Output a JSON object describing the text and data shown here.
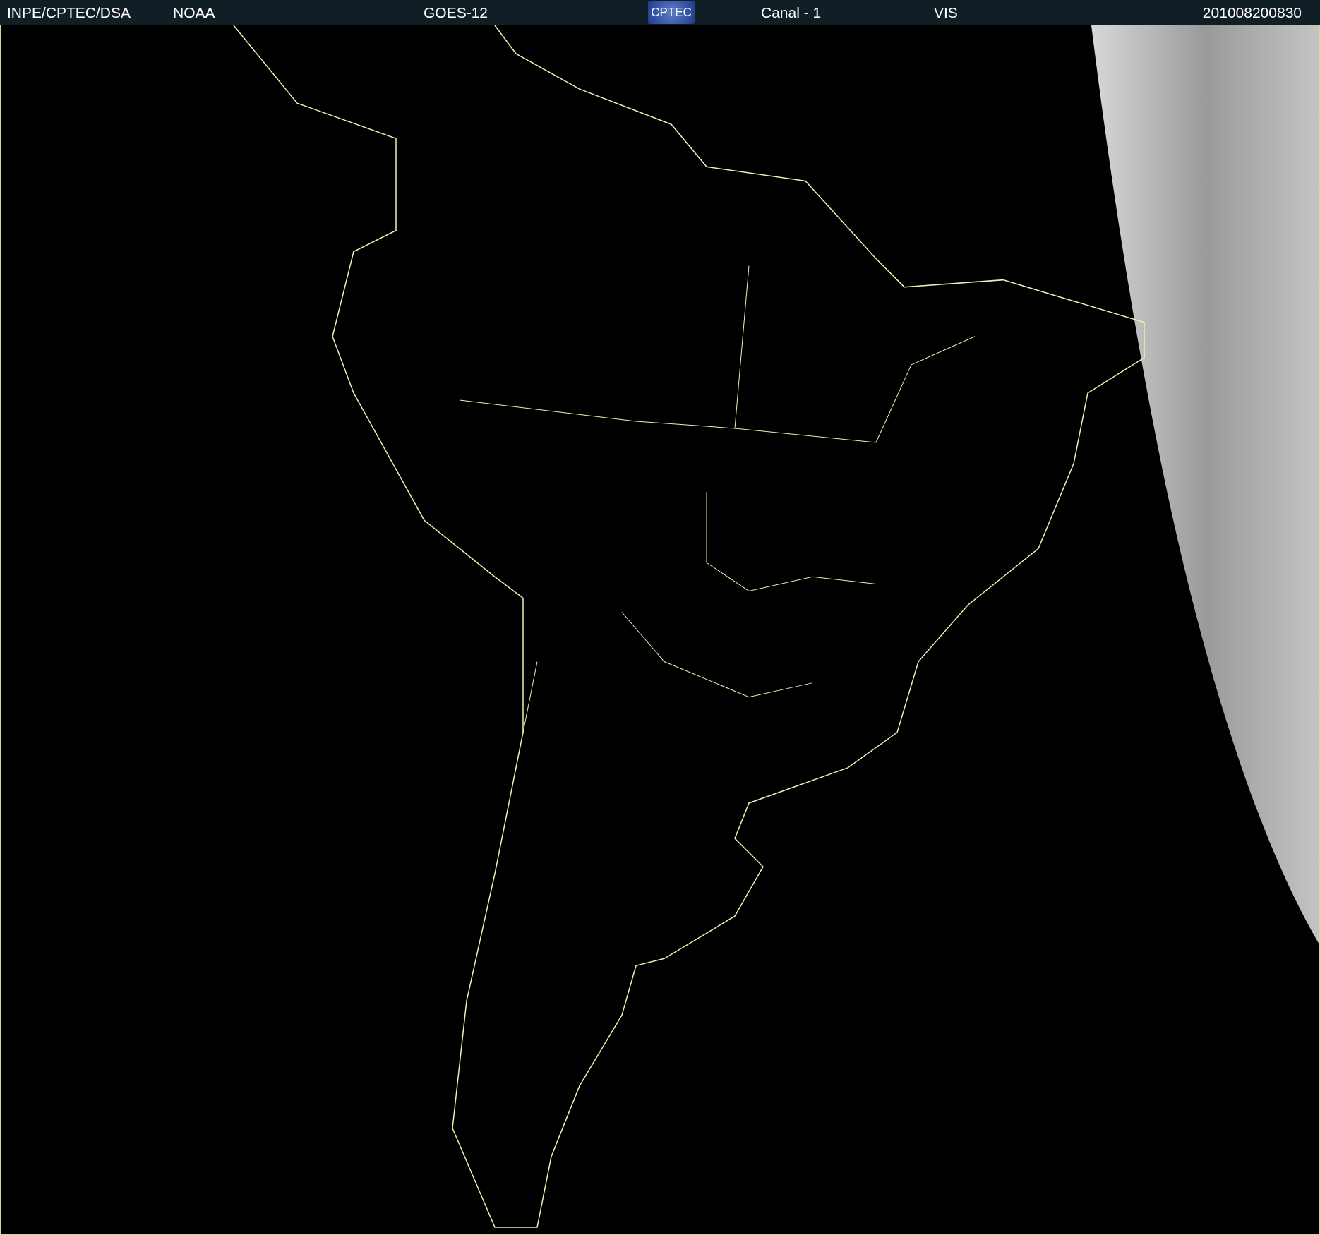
{
  "header": {
    "source": "INPE/CPTEC/DSA",
    "agency": "NOAA",
    "satellite": "GOES-12",
    "logo": "CPTEC",
    "channel": "Canal - 1",
    "band": "VIS",
    "timestamp": "201008200830"
  }
}
